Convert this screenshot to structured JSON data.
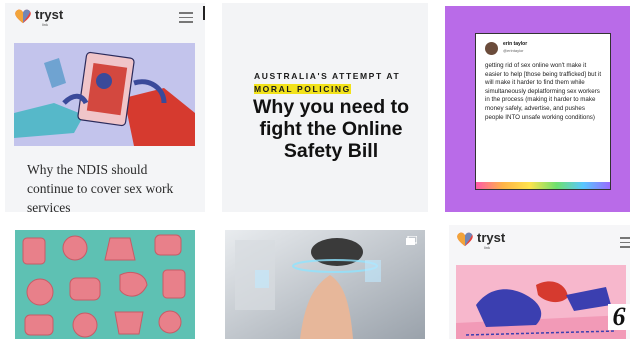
{
  "brand": {
    "name": "tryst",
    "sub": "link"
  },
  "tiles": {
    "ndis": {
      "title": "Why the NDIS should continue to cover sex work services"
    },
    "osb": {
      "kicker": "AUSTRALIA'S ATTEMPT AT",
      "kicker_highlight": "MORAL POLICING",
      "title": "Why you need to fight the Online Safety Bill"
    },
    "tweet": {
      "name": "erin taylor",
      "handle": "@erintaylor",
      "text": "getting rid of sex online won't make it easier to help [those being trafficked] but it will make it harder to find them while simultaneously deplatforming sex workers in the process (making it harder to make money safely, advertise, and pushes people INTO unsafe working conditions)"
    }
  },
  "page": {
    "badge": "6"
  },
  "colors": {
    "purple_tile": "#b96be8",
    "teal_tile": "#5ec1b3",
    "highlight": "#f2e21a",
    "illustration_red": "#d63a2f"
  },
  "icons": [
    "tryst-logo-icon",
    "hamburger-menu-icon",
    "heart-icon",
    "speech-bubble-icon"
  ]
}
